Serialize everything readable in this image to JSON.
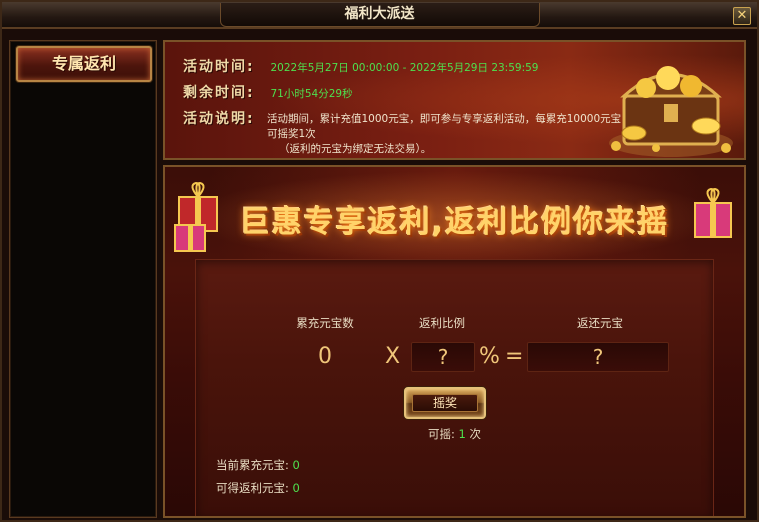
{
  "window": {
    "title": "福利大派送",
    "close_glyph": "✕"
  },
  "sidebar": {
    "items": [
      {
        "label": "专属返利",
        "active": true
      }
    ]
  },
  "info": {
    "time_label": "活动时间:",
    "time_value": "2022年5月27日 00:00:00 - 2022年5月29日 23:59:59",
    "remaining_label": "剩余时间:",
    "remaining_value": "71小时54分29秒",
    "desc_label": "活动说明:",
    "desc_line1": "活动期间，累计充值1000元宝，即可参与专享返利活动，每累充10000元宝可摇奖1次",
    "desc_line2": "（返利的元宝为绑定无法交易）。"
  },
  "banner": {
    "title": "巨惠专享返利,返利比例你来摇"
  },
  "calc": {
    "col1_label": "累充元宝数",
    "col2_label": "返利比例",
    "col3_label": "返还元宝",
    "total_value": "0",
    "times_sign": "X",
    "ratio_value": "?",
    "percent_sign": "%",
    "equals_sign": "=",
    "return_value": "?"
  },
  "shake": {
    "button_label": "摇奖",
    "count_label": "可摇:",
    "count_value": "1",
    "count_unit": "次"
  },
  "stats": {
    "current_label": "当前累充元宝:",
    "current_value": "0",
    "obtain_label": "可得返利元宝:",
    "obtain_value": "0"
  },
  "colors": {
    "highlight_green": "#4ee04e",
    "gold": "#ffd36a",
    "panel_red": "#5a140c"
  }
}
